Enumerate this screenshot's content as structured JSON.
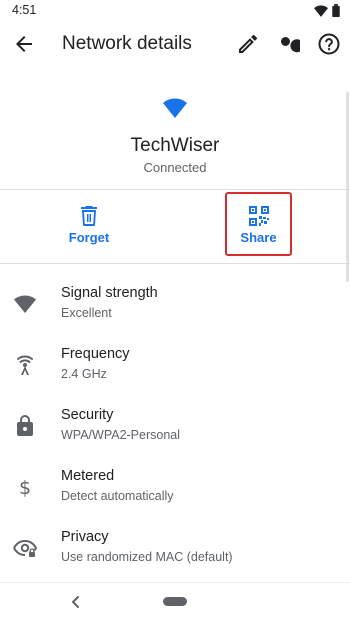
{
  "status_bar": {
    "time": "4:51"
  },
  "app_bar": {
    "title": "Network details"
  },
  "network": {
    "name": "TechWiser",
    "status": "Connected"
  },
  "actions": {
    "forget_label": "Forget",
    "share_label": "Share"
  },
  "details": [
    {
      "label": "Signal strength",
      "value": "Excellent",
      "icon": "wifi-signal-icon"
    },
    {
      "label": "Frequency",
      "value": "2.4 GHz",
      "icon": "antenna-icon"
    },
    {
      "label": "Security",
      "value": "WPA/WPA2-Personal",
      "icon": "lock-icon"
    },
    {
      "label": "Metered",
      "value": "Detect automatically",
      "icon": "dollar-icon"
    },
    {
      "label": "Privacy",
      "value": "Use randomized MAC (default)",
      "icon": "privacy-eye-icon"
    }
  ],
  "colors": {
    "accent": "#1a73e8",
    "highlight": "#d32f2f",
    "text": "#202124",
    "secondary": "#5f6368"
  }
}
